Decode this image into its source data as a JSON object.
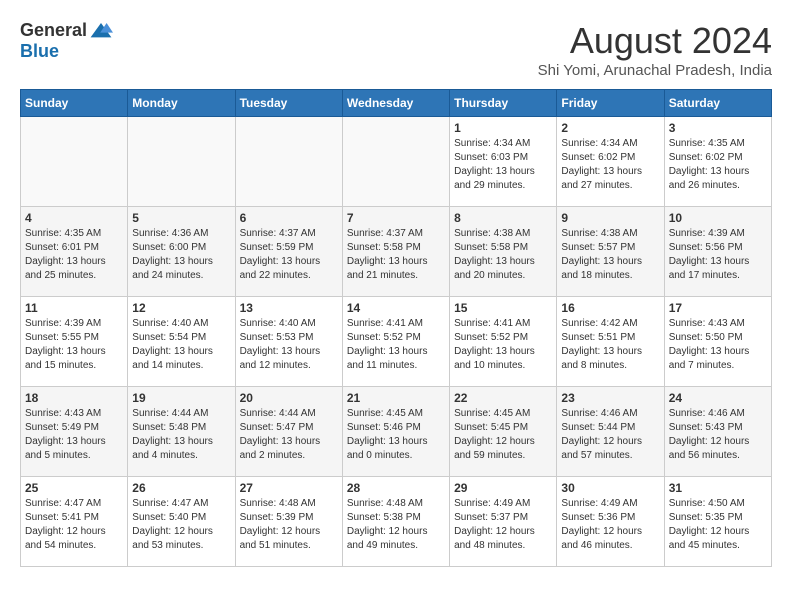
{
  "header": {
    "logo": {
      "general": "General",
      "blue": "Blue"
    },
    "title": "August 2024",
    "location": "Shi Yomi, Arunachal Pradesh, India"
  },
  "weekdays": [
    "Sunday",
    "Monday",
    "Tuesday",
    "Wednesday",
    "Thursday",
    "Friday",
    "Saturday"
  ],
  "weeks": [
    [
      {
        "day": "",
        "info": ""
      },
      {
        "day": "",
        "info": ""
      },
      {
        "day": "",
        "info": ""
      },
      {
        "day": "",
        "info": ""
      },
      {
        "day": "1",
        "info": "Sunrise: 4:34 AM\nSunset: 6:03 PM\nDaylight: 13 hours\nand 29 minutes."
      },
      {
        "day": "2",
        "info": "Sunrise: 4:34 AM\nSunset: 6:02 PM\nDaylight: 13 hours\nand 27 minutes."
      },
      {
        "day": "3",
        "info": "Sunrise: 4:35 AM\nSunset: 6:02 PM\nDaylight: 13 hours\nand 26 minutes."
      }
    ],
    [
      {
        "day": "4",
        "info": "Sunrise: 4:35 AM\nSunset: 6:01 PM\nDaylight: 13 hours\nand 25 minutes."
      },
      {
        "day": "5",
        "info": "Sunrise: 4:36 AM\nSunset: 6:00 PM\nDaylight: 13 hours\nand 24 minutes."
      },
      {
        "day": "6",
        "info": "Sunrise: 4:37 AM\nSunset: 5:59 PM\nDaylight: 13 hours\nand 22 minutes."
      },
      {
        "day": "7",
        "info": "Sunrise: 4:37 AM\nSunset: 5:58 PM\nDaylight: 13 hours\nand 21 minutes."
      },
      {
        "day": "8",
        "info": "Sunrise: 4:38 AM\nSunset: 5:58 PM\nDaylight: 13 hours\nand 20 minutes."
      },
      {
        "day": "9",
        "info": "Sunrise: 4:38 AM\nSunset: 5:57 PM\nDaylight: 13 hours\nand 18 minutes."
      },
      {
        "day": "10",
        "info": "Sunrise: 4:39 AM\nSunset: 5:56 PM\nDaylight: 13 hours\nand 17 minutes."
      }
    ],
    [
      {
        "day": "11",
        "info": "Sunrise: 4:39 AM\nSunset: 5:55 PM\nDaylight: 13 hours\nand 15 minutes."
      },
      {
        "day": "12",
        "info": "Sunrise: 4:40 AM\nSunset: 5:54 PM\nDaylight: 13 hours\nand 14 minutes."
      },
      {
        "day": "13",
        "info": "Sunrise: 4:40 AM\nSunset: 5:53 PM\nDaylight: 13 hours\nand 12 minutes."
      },
      {
        "day": "14",
        "info": "Sunrise: 4:41 AM\nSunset: 5:52 PM\nDaylight: 13 hours\nand 11 minutes."
      },
      {
        "day": "15",
        "info": "Sunrise: 4:41 AM\nSunset: 5:52 PM\nDaylight: 13 hours\nand 10 minutes."
      },
      {
        "day": "16",
        "info": "Sunrise: 4:42 AM\nSunset: 5:51 PM\nDaylight: 13 hours\nand 8 minutes."
      },
      {
        "day": "17",
        "info": "Sunrise: 4:43 AM\nSunset: 5:50 PM\nDaylight: 13 hours\nand 7 minutes."
      }
    ],
    [
      {
        "day": "18",
        "info": "Sunrise: 4:43 AM\nSunset: 5:49 PM\nDaylight: 13 hours\nand 5 minutes."
      },
      {
        "day": "19",
        "info": "Sunrise: 4:44 AM\nSunset: 5:48 PM\nDaylight: 13 hours\nand 4 minutes."
      },
      {
        "day": "20",
        "info": "Sunrise: 4:44 AM\nSunset: 5:47 PM\nDaylight: 13 hours\nand 2 minutes."
      },
      {
        "day": "21",
        "info": "Sunrise: 4:45 AM\nSunset: 5:46 PM\nDaylight: 13 hours\nand 0 minutes."
      },
      {
        "day": "22",
        "info": "Sunrise: 4:45 AM\nSunset: 5:45 PM\nDaylight: 12 hours\nand 59 minutes."
      },
      {
        "day": "23",
        "info": "Sunrise: 4:46 AM\nSunset: 5:44 PM\nDaylight: 12 hours\nand 57 minutes."
      },
      {
        "day": "24",
        "info": "Sunrise: 4:46 AM\nSunset: 5:43 PM\nDaylight: 12 hours\nand 56 minutes."
      }
    ],
    [
      {
        "day": "25",
        "info": "Sunrise: 4:47 AM\nSunset: 5:41 PM\nDaylight: 12 hours\nand 54 minutes."
      },
      {
        "day": "26",
        "info": "Sunrise: 4:47 AM\nSunset: 5:40 PM\nDaylight: 12 hours\nand 53 minutes."
      },
      {
        "day": "27",
        "info": "Sunrise: 4:48 AM\nSunset: 5:39 PM\nDaylight: 12 hours\nand 51 minutes."
      },
      {
        "day": "28",
        "info": "Sunrise: 4:48 AM\nSunset: 5:38 PM\nDaylight: 12 hours\nand 49 minutes."
      },
      {
        "day": "29",
        "info": "Sunrise: 4:49 AM\nSunset: 5:37 PM\nDaylight: 12 hours\nand 48 minutes."
      },
      {
        "day": "30",
        "info": "Sunrise: 4:49 AM\nSunset: 5:36 PM\nDaylight: 12 hours\nand 46 minutes."
      },
      {
        "day": "31",
        "info": "Sunrise: 4:50 AM\nSunset: 5:35 PM\nDaylight: 12 hours\nand 45 minutes."
      }
    ]
  ]
}
